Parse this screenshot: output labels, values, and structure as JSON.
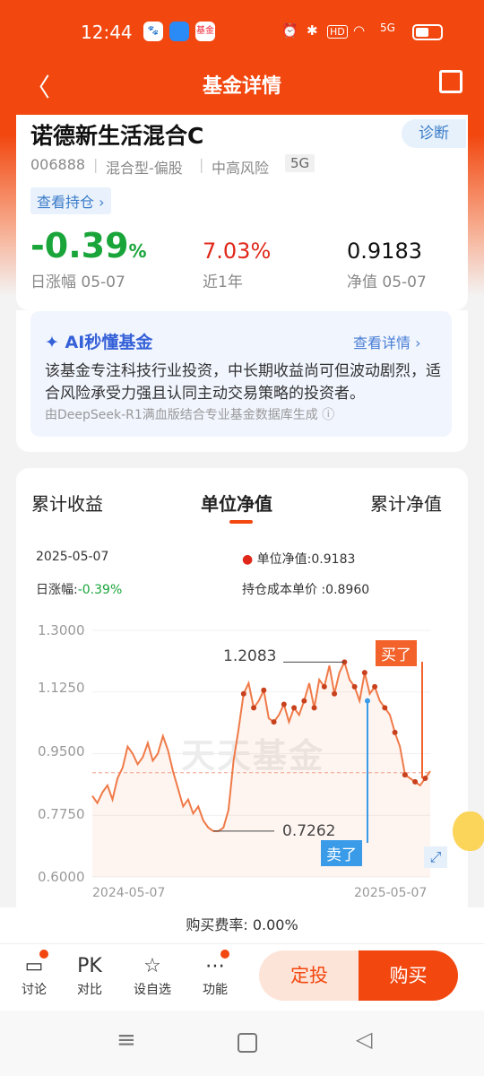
{
  "status": {
    "time": "12:44",
    "app_badge": "基金",
    "hd": "HD",
    "signal": "5G"
  },
  "nav": {
    "title": "基金详情"
  },
  "fund": {
    "name": "诺德新生活混合C",
    "code": "006888",
    "type": "混合型-偏股",
    "risk": "中高风险",
    "tag": "5G",
    "diagnose": "诊断",
    "holdings_link": "查看持仓",
    "daily_change": "-0.39",
    "percent_sign": "%",
    "daily_change_label": "日涨幅 05-07",
    "year_return": "7.03%",
    "year_label": "近1年",
    "nav_value": "0.9183",
    "nav_label": "净值 05-07"
  },
  "ai": {
    "title": "AI秒懂基金",
    "more": "查看详情",
    "text": "该基金专注科技行业投资，中长期收益尚可但波动剧烈，适合风险承受力强且认同主动交易策略的投资者。",
    "footer": "由DeepSeek-R1满血版结合专业基金数据库生成"
  },
  "tabs": [
    "累计收益",
    "单位净值",
    "累计净值"
  ],
  "info": {
    "date": "2025-05-07",
    "nav_label": "单位净值:",
    "nav_value": "0.9183",
    "change_label": "日涨幅:",
    "change_value": "-0.39%",
    "cost_label": "持仓成本单价 :",
    "cost_value": "0.8960"
  },
  "chart_data": {
    "type": "line",
    "x_start": "2024-05-07",
    "x_end": "2025-05-07",
    "y_ticks": [
      "1.3000",
      "1.1250",
      "0.9500",
      "0.7750",
      "0.6000"
    ],
    "ylim": [
      0.6,
      1.3
    ],
    "max_label": "1.2083",
    "min_label": "0.7262",
    "cost_line": 0.896,
    "sell_label": "卖了",
    "buy_label": "买了",
    "watermark": "天天基金",
    "values": [
      0.83,
      0.81,
      0.84,
      0.86,
      0.82,
      0.88,
      0.91,
      0.97,
      0.95,
      0.92,
      0.94,
      0.98,
      0.93,
      0.95,
      1.0,
      0.96,
      0.9,
      0.85,
      0.8,
      0.82,
      0.78,
      0.8,
      0.76,
      0.74,
      0.73,
      0.73,
      0.74,
      0.79,
      0.93,
      1.02,
      1.12,
      1.15,
      1.08,
      1.1,
      1.13,
      1.05,
      1.04,
      1.06,
      1.09,
      1.04,
      1.08,
      1.06,
      1.1,
      1.15,
      1.08,
      1.16,
      1.14,
      1.2,
      1.12,
      1.18,
      1.21,
      1.16,
      1.14,
      1.1,
      1.18,
      1.12,
      1.14,
      1.1,
      1.08,
      1.06,
      1.01,
      0.97,
      0.89,
      0.88,
      0.87,
      0.86,
      0.88,
      0.9
    ]
  },
  "footer": {
    "fee": "购买费率: 0.00%"
  },
  "bottom": {
    "discuss": "讨论",
    "pk": "PK",
    "compare": "对比",
    "fav": "设自选",
    "func": "功能",
    "auto_invest": "定投",
    "buy": "购买"
  }
}
